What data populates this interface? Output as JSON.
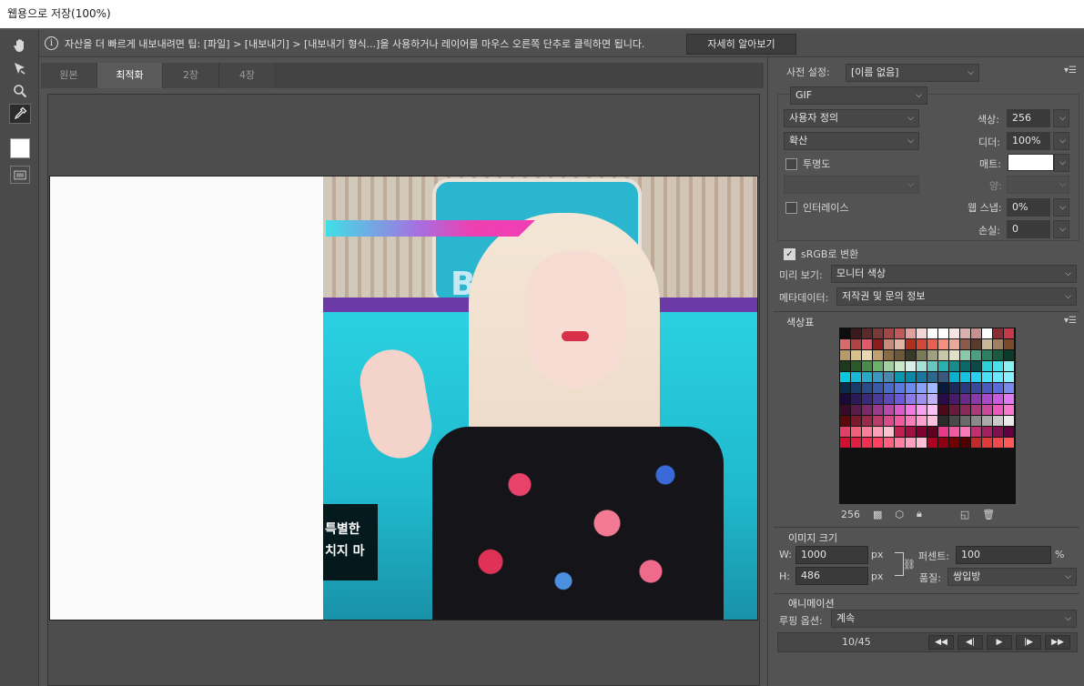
{
  "window": {
    "title": "웹용으로 저장(100%)"
  },
  "tools": [
    "hand-tool",
    "slice-select-tool",
    "zoom-tool",
    "eyedropper-tool",
    "eyedropper-color",
    "toggle-slices-visibility"
  ],
  "infobar": {
    "icon": "info-icon",
    "text": "자산을 더 빠르게 내보내려면 팁: [파일] > [내보내기] > [내보내기 형식...]을 사용하거나 레이어를 마우스 오른쪽 단추로 클릭하면 됩니다.",
    "learn_more": "자세히 알아보기"
  },
  "view_tabs": [
    {
      "label": "원본",
      "active": false
    },
    {
      "label": "최적화",
      "active": true
    },
    {
      "label": "2장",
      "active": false
    },
    {
      "label": "4장",
      "active": false
    }
  ],
  "image": {
    "caption_line1": "특별한",
    "caption_line2": "치지 마"
  },
  "preset": {
    "label": "사전 설정:",
    "value": "[이름 없음]"
  },
  "format": {
    "value": "GIF"
  },
  "reduction": {
    "value": "사용자 정의"
  },
  "dither_algorithm": {
    "value": "확산"
  },
  "colors": {
    "label": "색상:",
    "value": "256"
  },
  "dither": {
    "label": "디더:",
    "value": "100%"
  },
  "transparency": {
    "label": "투명도",
    "checked": false
  },
  "matte": {
    "label": "매트:",
    "color": "#ffffff"
  },
  "amount": {
    "label": "양:",
    "value": ""
  },
  "interlace": {
    "label": "인터레이스",
    "checked": false
  },
  "web_snap": {
    "label": "웹 스냅:",
    "value": "0%"
  },
  "lossy": {
    "label": "손실:",
    "value": "0"
  },
  "srgb": {
    "label": "sRGB로 변환",
    "checked": true
  },
  "preview": {
    "label": "미리 보기:",
    "value": "모니터 색상"
  },
  "metadata": {
    "label": "메타데이터:",
    "value": "저작권 및 문의 정보"
  },
  "color_table": {
    "title": "색상표",
    "count": "256",
    "colors": [
      "#0d0d0d",
      "#3a1a1a",
      "#5b2b2b",
      "#7a3a3a",
      "#a24545",
      "#c05a5a",
      "#e0a0a0",
      "#f5d6d6",
      "#ffffff",
      "#ffffff",
      "#f7e3e3",
      "#d8b0b0",
      "#c79090",
      "#ffffff",
      "#8a2c34",
      "#c53a4a",
      "#d96b6b",
      "#b04444",
      "#e05a6a",
      "#8a1d1d",
      "#c98a7a",
      "#e2b2a2",
      "#b0301e",
      "#d04a3c",
      "#e86050",
      "#f4917e",
      "#eaa89a",
      "#8a5a4a",
      "#5a3a2a",
      "#c9b79a",
      "#a08060",
      "#7a4a2a",
      "#b89a6a",
      "#d8c08a",
      "#e8d8b0",
      "#c0a070",
      "#8a6a40",
      "#6a5a3a",
      "#3a3a2a",
      "#7a7a5a",
      "#a0a080",
      "#c8c8a8",
      "#e0e0c8",
      "#8ac8a8",
      "#4aa080",
      "#2a8060",
      "#1a5a40",
      "#0a3a2a",
      "#1e3a1e",
      "#2a5a2a",
      "#4a8a4a",
      "#6ab06a",
      "#a0d0a0",
      "#c8e8c8",
      "#d8f0e8",
      "#a8e0d8",
      "#68c8c0",
      "#2ab0b0",
      "#1a8a8a",
      "#0a6a6a",
      "#0a4a4a",
      "#2ad0d8",
      "#4ae0e8",
      "#8af0f0",
      "#0ac8e0",
      "#1ab8d8",
      "#2aa8c8",
      "#3a98c0",
      "#4a88b0",
      "#0a98b0",
      "#0a88a8",
      "#1a78a0",
      "#2a6890",
      "#3a5880",
      "#0ab0d0",
      "#1ac0e0",
      "#2ad0f0",
      "#4ae0f8",
      "#6ae8ff",
      "#8af0ff",
      "#0a2a4a",
      "#1a3a6a",
      "#2a4a8a",
      "#3a5aa8",
      "#4a6ac8",
      "#5a7ae0",
      "#6a8af0",
      "#8aa0f8",
      "#a0b8ff",
      "#0a1a3a",
      "#1a2a5a",
      "#2a3a7a",
      "#3a4a9a",
      "#4a5aba",
      "#5a6ada",
      "#7a8aea",
      "#1a0a3a",
      "#2a1a5a",
      "#3a2a7a",
      "#4a3a9a",
      "#5a4aba",
      "#6a5ada",
      "#8a7aea",
      "#a090f0",
      "#c0b0f8",
      "#2a0a4a",
      "#4a1a6a",
      "#6a2a8a",
      "#8a3aaa",
      "#aa4aca",
      "#ca5ae0",
      "#e07af0",
      "#3a0a2a",
      "#5a1a4a",
      "#7a2a6a",
      "#9a3a8a",
      "#ba4aaa",
      "#da5aca",
      "#f07ae0",
      "#f8a0f0",
      "#ffc0f8",
      "#4a0a1a",
      "#6a1a3a",
      "#8a2a5a",
      "#aa3a7a",
      "#ca4a9a",
      "#ea5aba",
      "#f87ad0",
      "#5a0a0a",
      "#7a1a2a",
      "#9a2a4a",
      "#ba3a6a",
      "#da4a8a",
      "#f05aa0",
      "#f87ab8",
      "#ffa0d0",
      "#ffc0e0",
      "#2a2a2a",
      "#4a4a4a",
      "#6a6a6a",
      "#8a8a8a",
      "#aaaaaa",
      "#cacaca",
      "#eaeaea",
      "#e0406a",
      "#f0607a",
      "#f8809a",
      "#ffa0b8",
      "#ffc0d0",
      "#c02050",
      "#a01040",
      "#800030",
      "#600020",
      "#e83a8a",
      "#f05aa0",
      "#f87ab8",
      "#c03070",
      "#a02060",
      "#801050",
      "#600040",
      "#d01030",
      "#e02040",
      "#f03050",
      "#ff4060",
      "#ff6080",
      "#ff80a0",
      "#ffa0c0",
      "#ffc0d8",
      "#b00020",
      "#900010",
      "#700000",
      "#500000",
      "#c02a2a",
      "#e03a3a",
      "#f04a4a",
      "#ff5a5a"
    ]
  },
  "image_size": {
    "title": "이미지 크기",
    "w_label": "W:",
    "w_value": "1000",
    "h_label": "H:",
    "h_value": "486",
    "unit": "px",
    "percent_label": "퍼센트:",
    "percent_value": "100",
    "percent_unit": "%",
    "quality_label": "품질:",
    "quality_value": "쌍입방"
  },
  "animation": {
    "title": "애니메이션",
    "loop_label": "루핑 옵션:",
    "loop_value": "계속",
    "frame": "10/45",
    "buttons": [
      "◀◀",
      "◀|",
      "▶",
      "|▶",
      "▶▶"
    ]
  }
}
